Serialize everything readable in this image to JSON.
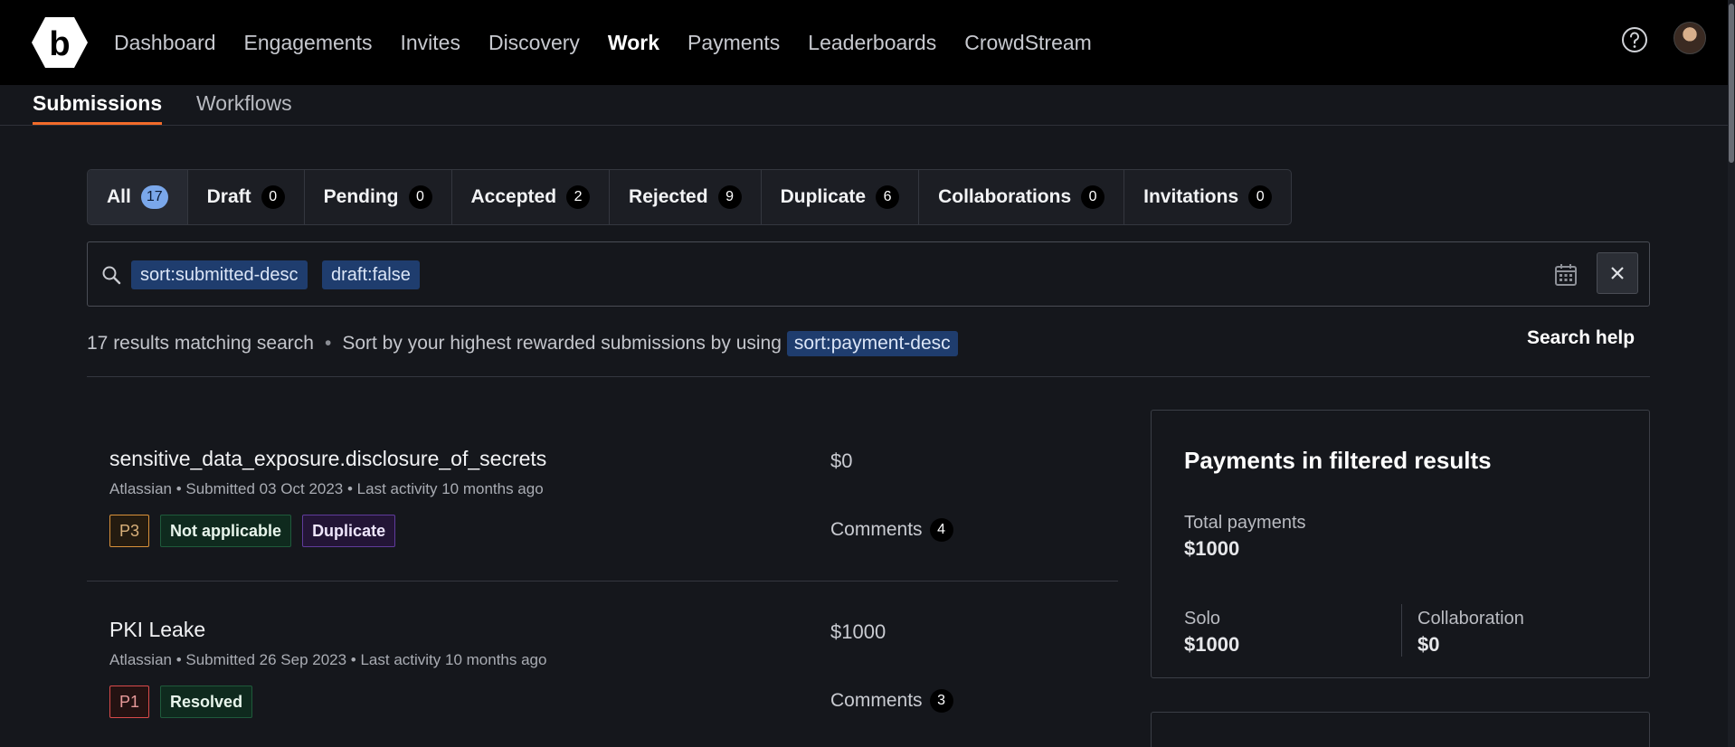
{
  "nav": {
    "items": [
      "Dashboard",
      "Engagements",
      "Invites",
      "Discovery",
      "Work",
      "Payments",
      "Leaderboards",
      "CrowdStream"
    ],
    "active": "Work"
  },
  "subtabs": [
    "Submissions",
    "Workflows"
  ],
  "status_tabs": [
    {
      "label": "All",
      "count": "17"
    },
    {
      "label": "Draft",
      "count": "0"
    },
    {
      "label": "Pending",
      "count": "0"
    },
    {
      "label": "Accepted",
      "count": "2"
    },
    {
      "label": "Rejected",
      "count": "9"
    },
    {
      "label": "Duplicate",
      "count": "6"
    },
    {
      "label": "Collaborations",
      "count": "0"
    },
    {
      "label": "Invitations",
      "count": "0"
    }
  ],
  "search": {
    "chips": [
      "sort:submitted-desc",
      "draft:false"
    ]
  },
  "results": {
    "count_text": "17 results matching search",
    "sort_hint": "Sort by your highest rewarded submissions by using",
    "sort_code": "sort:payment-desc",
    "search_help": "Search help"
  },
  "submissions": [
    {
      "title": "sensitive_data_exposure.disclosure_of_secrets",
      "meta": "Atlassian • Submitted 03 Oct 2023 • Last activity 10 months ago",
      "priority": "P3",
      "badges": [
        "Not applicable",
        "Duplicate"
      ],
      "amount": "$0",
      "comments_label": "Comments",
      "comments_count": "4"
    },
    {
      "title": "PKI Leake",
      "meta": "Atlassian • Submitted 26 Sep 2023 • Last activity 10 months ago",
      "priority": "P1",
      "badges": [
        "Resolved"
      ],
      "amount": "$1000",
      "comments_label": "Comments",
      "comments_count": "3"
    }
  ],
  "payments": {
    "title": "Payments in filtered results",
    "total_label": "Total payments",
    "total_value": "$1000",
    "solo_label": "Solo",
    "solo_value": "$1000",
    "collab_label": "Collaboration",
    "collab_value": "$0"
  },
  "colors": {
    "accent_underline": "#f26b2a",
    "chip_bg": "#1f3d6e",
    "active_count_bg": "#7aa7ea"
  }
}
